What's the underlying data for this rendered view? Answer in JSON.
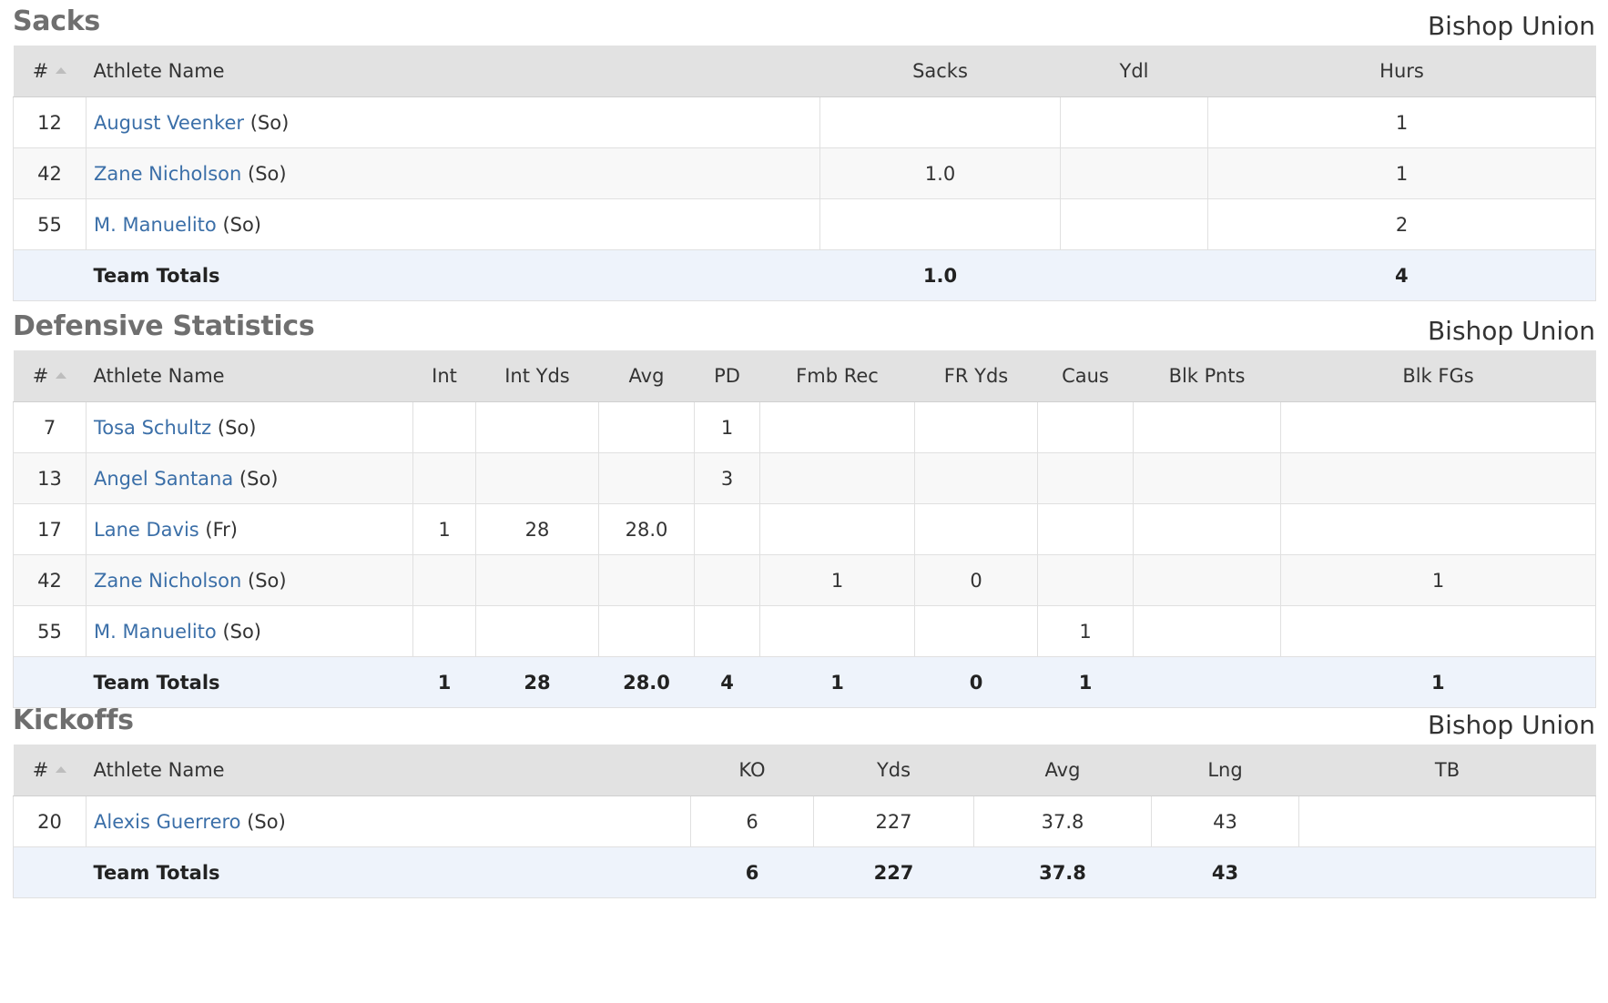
{
  "sacks": {
    "title": "Sacks",
    "team": "Bishop Union",
    "headers": [
      "#",
      "Athlete Name",
      "Sacks",
      "Ydl",
      "Hurs"
    ],
    "rows": [
      {
        "num": "12",
        "name": "August Veenker",
        "cls": "(So)",
        "cells": [
          "",
          "",
          "1"
        ]
      },
      {
        "num": "42",
        "name": "Zane Nicholson",
        "cls": "(So)",
        "cells": [
          "1.0",
          "",
          "1"
        ]
      },
      {
        "num": "55",
        "name": "M. Manuelito",
        "cls": "(So)",
        "cells": [
          "",
          "",
          "2"
        ]
      }
    ],
    "totals": {
      "label": "Team Totals",
      "cells": [
        "1.0",
        "",
        "4"
      ]
    }
  },
  "defense": {
    "title": "Defensive Statistics",
    "team": "Bishop Union",
    "headers": [
      "#",
      "Athlete Name",
      "Int",
      "Int Yds",
      "Avg",
      "PD",
      "Fmb Rec",
      "FR Yds",
      "Caus",
      "Blk Pnts",
      "Blk FGs"
    ],
    "rows": [
      {
        "num": "7",
        "name": "Tosa Schultz",
        "cls": "(So)",
        "cells": [
          "",
          "",
          "",
          "1",
          "",
          "",
          "",
          "",
          ""
        ]
      },
      {
        "num": "13",
        "name": "Angel Santana",
        "cls": "(So)",
        "cells": [
          "",
          "",
          "",
          "3",
          "",
          "",
          "",
          "",
          ""
        ]
      },
      {
        "num": "17",
        "name": "Lane Davis",
        "cls": "(Fr)",
        "cells": [
          "1",
          "28",
          "28.0",
          "",
          "",
          "",
          "",
          "",
          ""
        ]
      },
      {
        "num": "42",
        "name": "Zane Nicholson",
        "cls": "(So)",
        "cells": [
          "",
          "",
          "",
          "",
          "1",
          "0",
          "",
          "",
          "1"
        ]
      },
      {
        "num": "55",
        "name": "M. Manuelito",
        "cls": "(So)",
        "cells": [
          "",
          "",
          "",
          "",
          "",
          "",
          "1",
          "",
          ""
        ]
      }
    ],
    "totals": {
      "label": "Team Totals",
      "cells": [
        "1",
        "28",
        "28.0",
        "4",
        "1",
        "0",
        "1",
        "",
        "1"
      ]
    }
  },
  "kickoffs": {
    "title": "Kickoffs",
    "team": "Bishop Union",
    "headers": [
      "#",
      "Athlete Name",
      "KO",
      "Yds",
      "Avg",
      "Lng",
      "TB"
    ],
    "rows": [
      {
        "num": "20",
        "name": "Alexis Guerrero",
        "cls": "(So)",
        "cells": [
          "6",
          "227",
          "37.8",
          "43",
          ""
        ]
      }
    ],
    "totals": {
      "label": "Team Totals",
      "cells": [
        "6",
        "227",
        "37.8",
        "43",
        ""
      ]
    }
  }
}
